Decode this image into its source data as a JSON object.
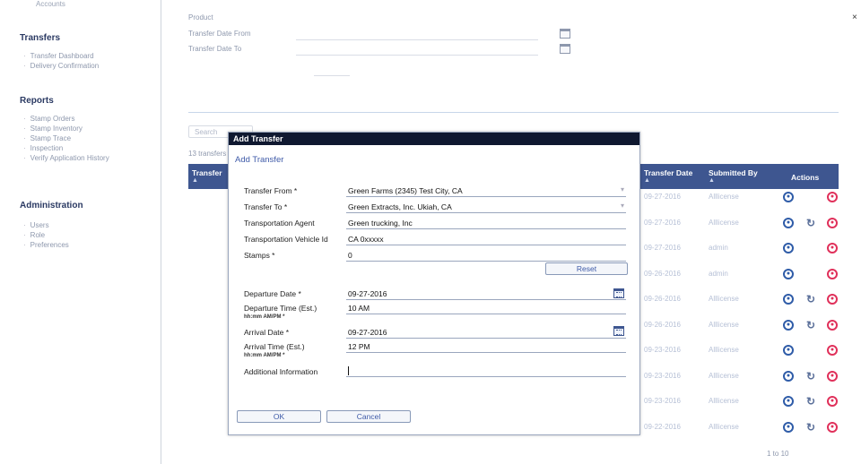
{
  "sidebar": {
    "scrolled_item": "Accounts",
    "sections": [
      {
        "title": "Transfers",
        "items": [
          "Transfer Dashboard",
          "Delivery Confirmation"
        ]
      },
      {
        "title": "Reports",
        "items": [
          "Stamp Orders",
          "Stamp Inventory",
          "Stamp Trace",
          "Inspection",
          "Verify Application History"
        ]
      },
      {
        "title": "Administration",
        "items": [
          "Users",
          "Role",
          "Preferences"
        ]
      }
    ]
  },
  "filters": {
    "product_label": "Product",
    "date_from_label": "Transfer Date From",
    "date_to_label": "Transfer Date To",
    "search_button": "Search",
    "count_text": "13 transfers"
  },
  "grid": {
    "col_transfer": "Transfer",
    "col_transfer_date": "Transfer Date",
    "col_submitted_by": "Submitted By",
    "col_actions": "Actions",
    "rows": [
      {
        "date": "09-27-2016",
        "by": "Alllicense",
        "edit": false
      },
      {
        "date": "09-27-2016",
        "by": "Alllicense",
        "edit": true
      },
      {
        "date": "09-27-2016",
        "by": "admin",
        "edit": false
      },
      {
        "date": "09-26-2016",
        "by": "admin",
        "edit": false
      },
      {
        "date": "09-26-2016",
        "by": "Alllicense",
        "edit": true
      },
      {
        "date": "09-26-2016",
        "by": "Alllicense",
        "edit": true
      },
      {
        "date": "09-23-2016",
        "by": "Alllicense",
        "edit": false
      },
      {
        "date": "09-23-2016",
        "by": "Alllicense",
        "edit": true
      },
      {
        "date": "09-23-2016",
        "by": "Alllicense",
        "edit": true
      },
      {
        "date": "09-22-2016",
        "by": "Alllicense",
        "edit": true
      }
    ],
    "pager": "1 to 10"
  },
  "modal": {
    "title": "Add Transfer",
    "subtitle": "Add Transfer",
    "transfer_from_label": "Transfer From *",
    "transfer_from_value": "Green Farms (2345)  Test City, CA",
    "transfer_to_label": "Transfer To *",
    "transfer_to_value": "Green Extracts, Inc.  Ukiah, CA",
    "agent_label": "Transportation Agent",
    "agent_value": "Green trucking, Inc",
    "vehicle_label": "Transportation Vehicle Id",
    "vehicle_value": "CA 0xxxxx",
    "stamps_label": "Stamps *",
    "stamps_value": "0",
    "reset_label": "Reset",
    "departure_date_label": "Departure Date *",
    "departure_date_value": "09-27-2016",
    "departure_time_label": "Departure Time (Est.)",
    "departure_time_hint": "hh:mm AM/PM *",
    "departure_time_value": "10 AM",
    "arrival_date_label": "Arrival Date *",
    "arrival_date_value": "09-27-2016",
    "arrival_time_label": "Arrival Time (Est.)",
    "arrival_time_hint": "hh:mm AM/PM *",
    "arrival_time_value": "12 PM",
    "additional_label": "Additional Information",
    "ok_label": "OK",
    "cancel_label": "Cancel"
  }
}
